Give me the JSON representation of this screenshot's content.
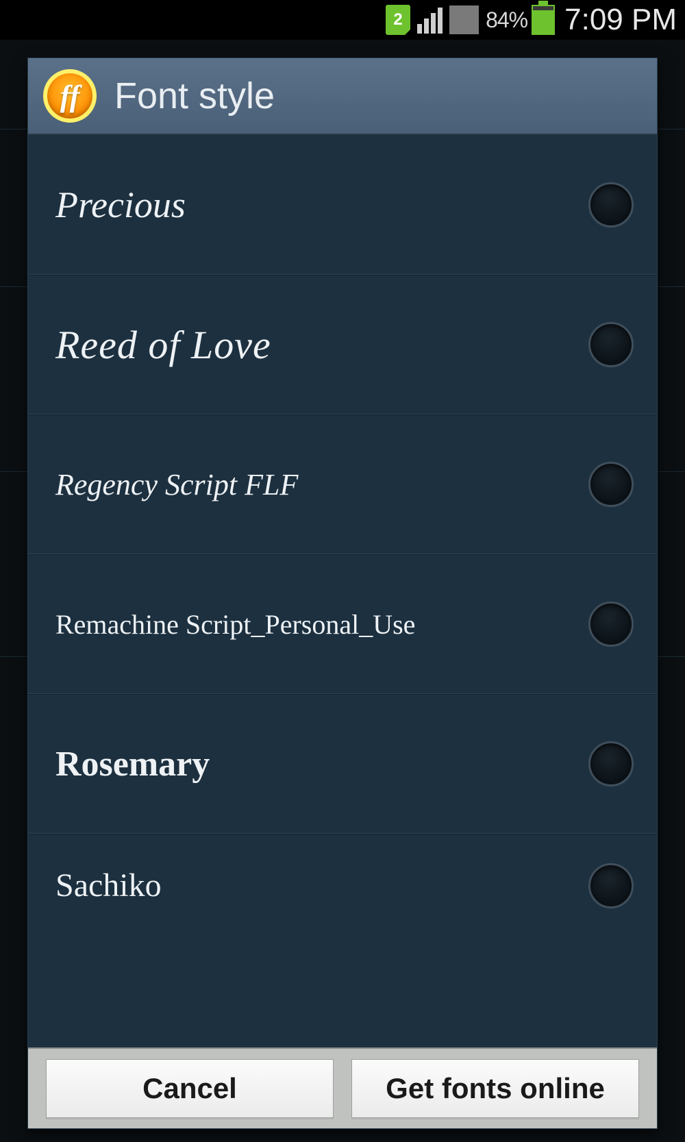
{
  "status": {
    "sim_number": "2",
    "battery_pct": "84%",
    "time": "7:09 PM"
  },
  "dialog": {
    "icon_text": "ff",
    "title": "Font style",
    "fonts": [
      {
        "label": "Precious"
      },
      {
        "label": "Reed of Love"
      },
      {
        "label": "Regency Script FLF"
      },
      {
        "label": "Remachine Script_Personal_Use"
      },
      {
        "label": "Rosemary"
      },
      {
        "label": "Sachiko"
      }
    ],
    "buttons": {
      "cancel": "Cancel",
      "get_online": "Get fonts online"
    }
  }
}
